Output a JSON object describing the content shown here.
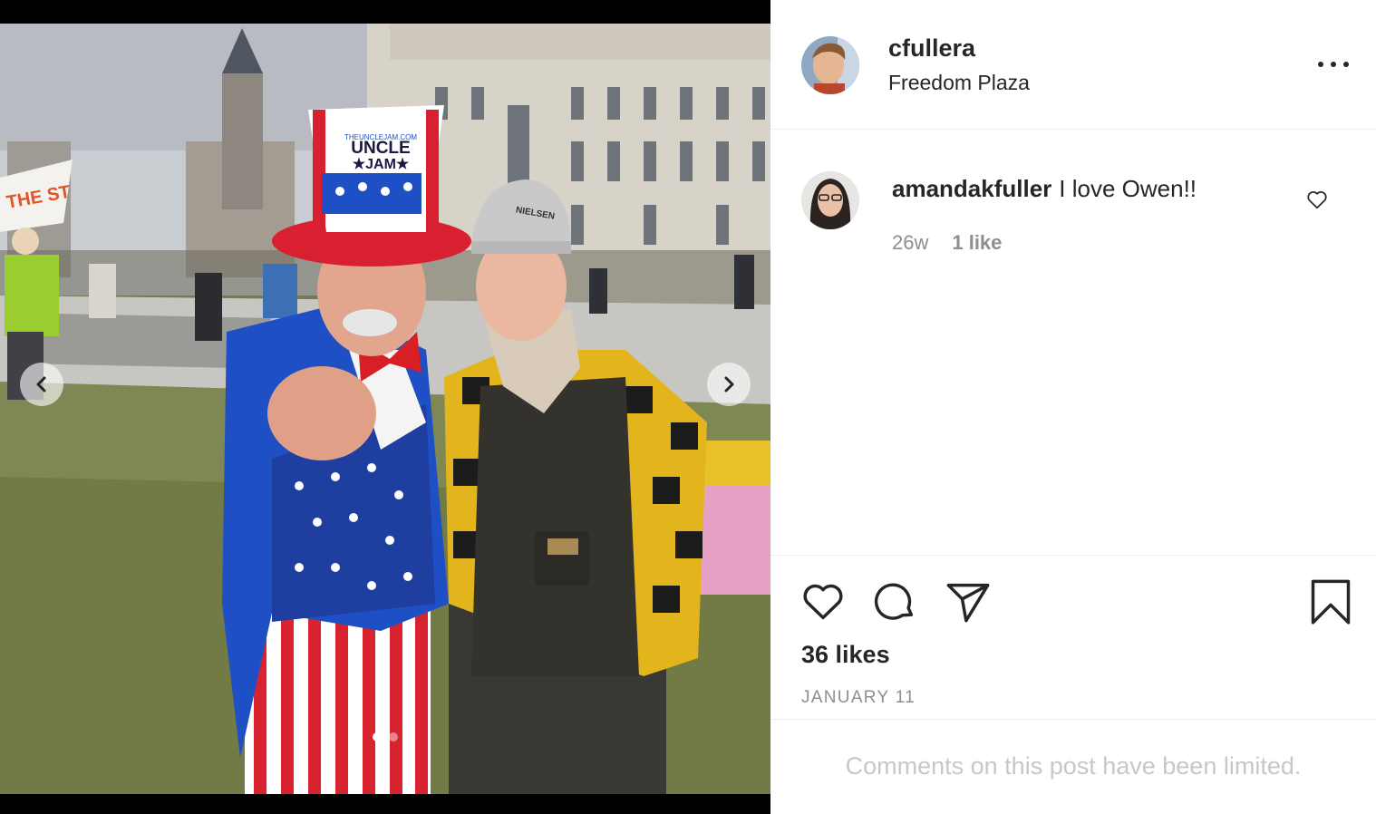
{
  "post": {
    "username": "cfullera",
    "location": "Freedom Plaza",
    "likes_text": "36 likes",
    "date": "JANUARY 11",
    "comments_limited_text": "Comments on this post have been limited."
  },
  "photo": {
    "hat_brand_small": "THEUNCLEJAM.COM",
    "hat_brand_line1": "UNCLE",
    "hat_brand_line2": "★JAM★",
    "cap_text": "NIELSEN",
    "banner_text": "THE ST"
  },
  "carousel": {
    "slide_count": 2,
    "active_index": 0
  },
  "comments": [
    {
      "username": "amandakfuller",
      "text": "I love Owen!!",
      "age": "26w",
      "likes": "1 like"
    }
  ],
  "icons": {
    "more": "more-options-icon",
    "like": "heart-icon",
    "comment": "speech-bubble-icon",
    "share": "paper-plane-icon",
    "save": "bookmark-icon",
    "prev": "chevron-left-icon",
    "next": "chevron-right-icon"
  },
  "colors": {
    "text_primary": "#262626",
    "text_secondary": "#8e8e8e",
    "text_muted": "#c7c7c7",
    "divider": "#efefef"
  }
}
